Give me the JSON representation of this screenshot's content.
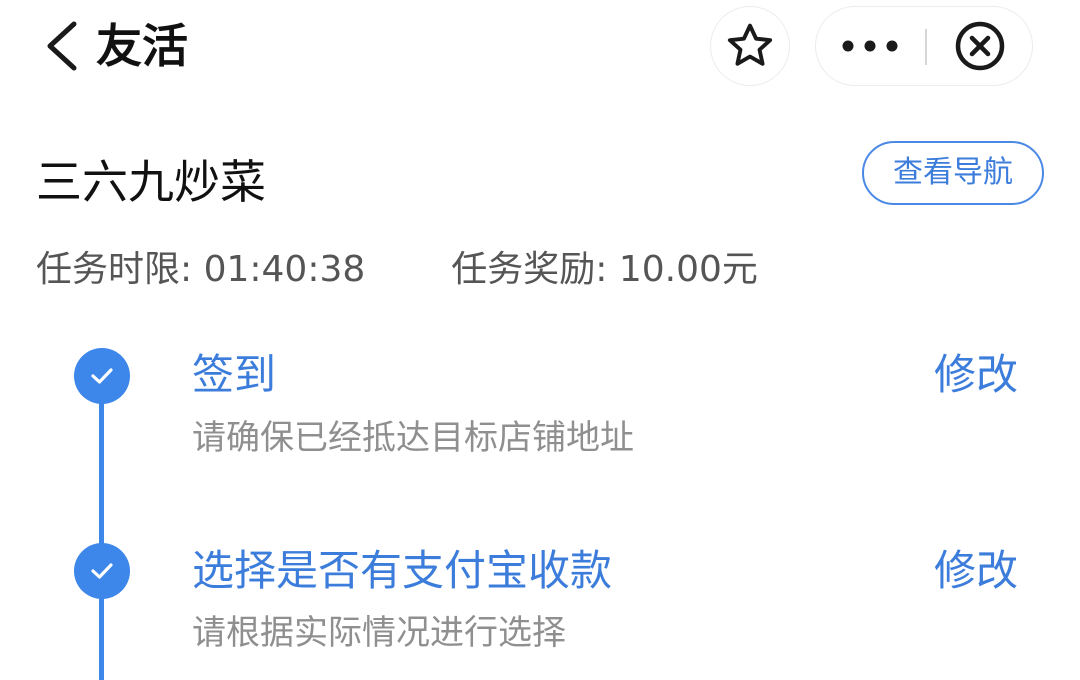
{
  "header": {
    "title": "友活",
    "back_icon": "chevron-left-icon",
    "favorite_icon": "star-icon",
    "more_icon": "more-dots-icon",
    "close_icon": "close-circle-icon"
  },
  "store": {
    "name": "三六九炒菜",
    "nav_button_label": "查看导航"
  },
  "task": {
    "time_limit": "任务时限: 01:40:38",
    "reward": "任务奖励: 10.00元"
  },
  "steps": [
    {
      "title": "签到",
      "desc": "请确保已经抵达目标店铺地址",
      "action": "修改",
      "status": "completed",
      "icon": "check-icon"
    },
    {
      "title": "选择是否有支付宝收款",
      "desc": "请根据实际情况进行选择",
      "action": "修改",
      "status": "completed",
      "icon": "check-icon"
    }
  ],
  "colors": {
    "accent": "#3d86ea",
    "accent_text": "#3c7ddc",
    "secondary_text": "#8f8f8f",
    "meta_text": "#555555"
  }
}
